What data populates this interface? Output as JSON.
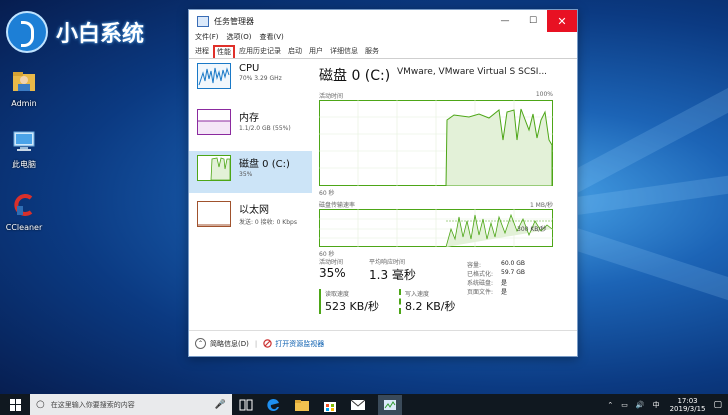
{
  "desktop": {
    "logo_text": "小白系统",
    "icons": [
      {
        "label": "Admin"
      },
      {
        "label": "此电脑"
      },
      {
        "label": "CCleaner"
      }
    ]
  },
  "window": {
    "title": "任务管理器",
    "controls": {
      "minimize": "—",
      "maximize": "☐",
      "close": "✕"
    },
    "menu": [
      "文件(F)",
      "选项(O)",
      "查看(V)"
    ],
    "tabs": [
      "进程",
      "性能",
      "应用历史记录",
      "启动",
      "用户",
      "详细信息",
      "服务"
    ],
    "active_tab": "性能",
    "resources": [
      {
        "name": "CPU",
        "detail": "70% 3.29 GHz",
        "color": "#1a79c7"
      },
      {
        "name": "内存",
        "detail": "1.1/2.0 GB (55%)",
        "color": "#8b2a9f"
      },
      {
        "name": "磁盘 0 (C:)",
        "detail": "35%",
        "color": "#4da617",
        "selected": true
      },
      {
        "name": "以太网",
        "detail": "发送: 0 接收: 0 Kbps",
        "color": "#a0522d"
      }
    ],
    "disk": {
      "title": "磁盘 0 (C:)",
      "model": "VMware, VMware Virtual S SCSI...",
      "activity_label": "活动时间",
      "activity_max": "100%",
      "time_label": "60 秒",
      "transfer_label": "磁盘传输速率",
      "transfer_max": "1 MB/秒",
      "transfer_mark": "300 KB/秒",
      "stats": {
        "active_time_label": "活动时间",
        "active_time": "35%",
        "avg_response_label": "平均响应时间",
        "avg_response": "1.3 毫秒",
        "read_label": "读取速度",
        "read": "523 KB/秒",
        "write_label": "写入速度",
        "write": "8.2 KB/秒"
      },
      "info": [
        {
          "k": "容量:",
          "v": "60.0 GB"
        },
        {
          "k": "已格式化:",
          "v": "59.7 GB"
        },
        {
          "k": "系统磁盘:",
          "v": "是"
        },
        {
          "k": "页面文件:",
          "v": "是"
        }
      ]
    },
    "footer": {
      "brief": "简略信息(D)",
      "monitor": "打开资源监视器"
    }
  },
  "taskbar": {
    "search_placeholder": "在这里输入你要搜索的内容",
    "time": "17:03",
    "date": "2019/3/15",
    "lang": "中"
  },
  "colors": {
    "disk_green": "#4da617",
    "accent_blue": "#1a79c7",
    "close_red": "#e81123",
    "highlight_red": "#e0302a"
  }
}
